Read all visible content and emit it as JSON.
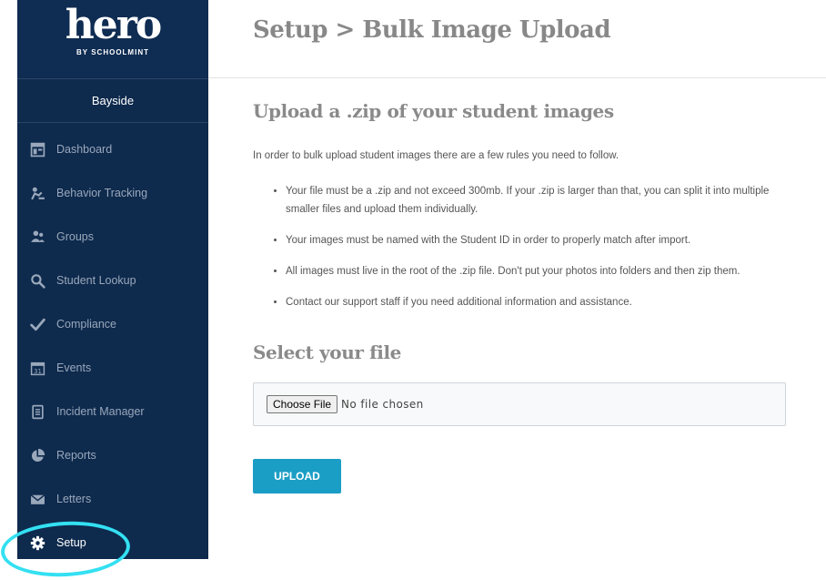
{
  "brand": {
    "logo": "hero",
    "tagline": "BY SCHOOLMINT"
  },
  "sidebar": {
    "school": "Bayside",
    "items": [
      {
        "label": "Dashboard",
        "icon": "dashboard-icon"
      },
      {
        "label": "Behavior Tracking",
        "icon": "behavior-tracking-icon"
      },
      {
        "label": "Groups",
        "icon": "groups-icon"
      },
      {
        "label": "Student Lookup",
        "icon": "search-icon"
      },
      {
        "label": "Compliance",
        "icon": "checkmark-icon"
      },
      {
        "label": "Events",
        "icon": "calendar-icon"
      },
      {
        "label": "Incident Manager",
        "icon": "document-icon"
      },
      {
        "label": "Reports",
        "icon": "pie-chart-icon"
      },
      {
        "label": "Letters",
        "icon": "envelope-icon"
      },
      {
        "label": "Setup",
        "icon": "gear-icon",
        "active": true
      }
    ]
  },
  "header": {
    "title": "Setup > Bulk Image Upload"
  },
  "main": {
    "heading": "Upload a .zip of your student images",
    "intro": "In order to bulk upload student images there are a few rules you need to follow.",
    "rules": [
      "Your file must be a .zip and not exceed 300mb. If your .zip is larger than that, you can split it into multiple smaller files and upload them individually.",
      "Your images must be named with the Student ID in order to properly match after import.",
      "All images must live in the root of the .zip file. Don't put your photos into folders and then zip them.",
      "Contact our support staff if you need additional information and assistance."
    ],
    "file_heading": "Select your file",
    "choose_file_label": "Choose File",
    "no_file_text": "No file chosen",
    "upload_label": "UPLOAD"
  },
  "colors": {
    "sidebar_bg": "#0e2a4d",
    "accent": "#1b9ec5",
    "annotation": "#33e0f2"
  }
}
